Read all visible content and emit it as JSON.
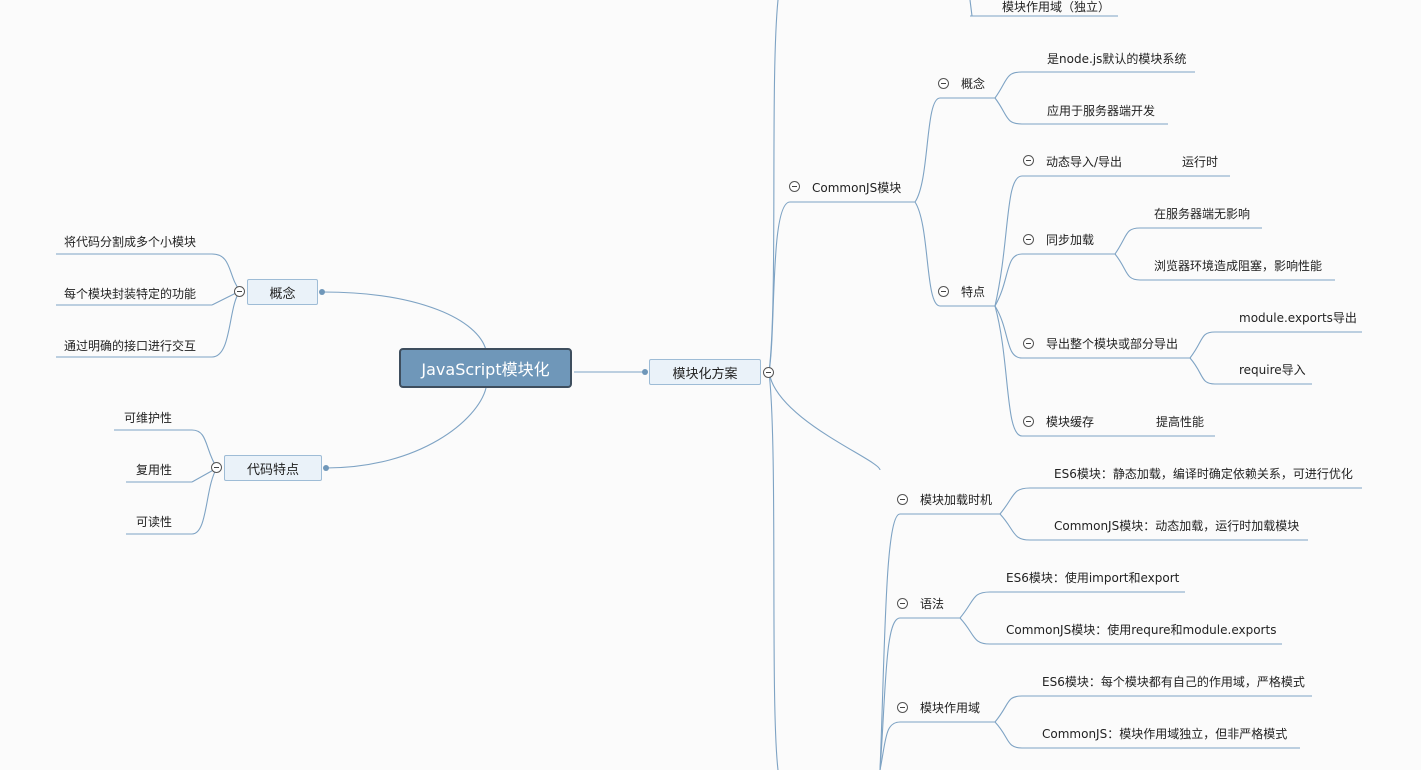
{
  "root": {
    "label": "JavaScript模块化"
  },
  "left": {
    "concept": {
      "label": "概念",
      "items": [
        "将代码分割成多个小模块",
        "每个模块封装特定的功能",
        "通过明确的接口进行交互"
      ]
    },
    "code_traits": {
      "label": "代码特点",
      "items": [
        "可维护性",
        "复用性",
        "可读性"
      ]
    }
  },
  "right": {
    "solutions": {
      "label": "模块化方案",
      "top_partial": "模块作用域（独立）",
      "commonjs": {
        "label": "CommonJS模块",
        "concept": {
          "label": "概念",
          "items": [
            "是node.js默认的模块系统",
            "应用于服务器端开发"
          ]
        },
        "traits": {
          "label": "特点",
          "dynamic": {
            "label": "动态导入/导出",
            "child": "运行时"
          },
          "sync": {
            "label": "同步加载",
            "items": [
              "在服务器端无影响",
              "浏览器环境造成阻塞，影响性能"
            ]
          },
          "export": {
            "label": "导出整个模块或部分导出",
            "items": [
              "module.exports导出",
              "require导入"
            ]
          },
          "cache": {
            "label": "模块缓存",
            "child": "提高性能"
          }
        }
      },
      "compare": {
        "timing": {
          "label": "模块加载时机",
          "items": [
            "ES6模块：静态加载，编译时确定依赖关系，可进行优化",
            "CommonJS模块：动态加载，运行时加载模块"
          ]
        },
        "syntax": {
          "label": "语法",
          "items": [
            "ES6模块：使用import和export",
            "CommonJS模块：使用requre和module.exports"
          ]
        },
        "scope": {
          "label": "模块作用域",
          "items": [
            "ES6模块：每个模块都有自己的作用域，严格模式",
            "CommonJS：模块作用域独立，但非严格模式"
          ]
        }
      }
    }
  },
  "colors": {
    "line": "#7ea3c4",
    "root_fill": "#6f97b9",
    "root_border": "#3e4e5e",
    "box_fill": "#eaf2f9"
  }
}
